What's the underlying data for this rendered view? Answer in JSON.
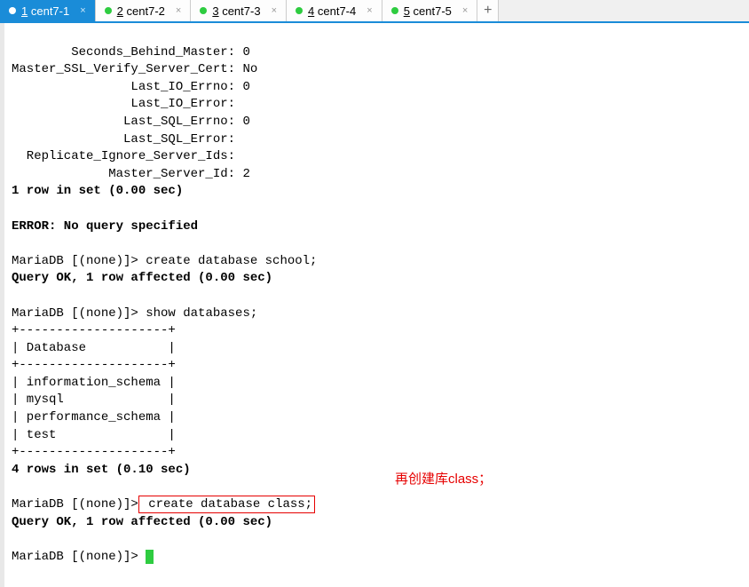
{
  "tabs": [
    {
      "num": "1",
      "label": "cent7-1",
      "active": true
    },
    {
      "num": "2",
      "label": "cent7-2",
      "active": false
    },
    {
      "num": "3",
      "label": "cent7-3",
      "active": false
    },
    {
      "num": "4",
      "label": "cent7-4",
      "active": false
    },
    {
      "num": "5",
      "label": "cent7-5",
      "active": false
    }
  ],
  "close_glyph": "×",
  "add_glyph": "+",
  "terminal": {
    "status_lines": [
      "        Seconds_Behind_Master: 0",
      "Master_SSL_Verify_Server_Cert: No",
      "                Last_IO_Errno: 0",
      "                Last_IO_Error:",
      "               Last_SQL_Errno: 0",
      "               Last_SQL_Error:",
      "  Replicate_Ignore_Server_Ids:",
      "             Master_Server_Id: 2"
    ],
    "row_in_set_1": "1 row in set (0.00 sec)",
    "error_line": "ERROR: No query specified",
    "prompt": "MariaDB [(none)]>",
    "cmd_create_school": " create database school;",
    "ok_1": "Query OK, 1 row affected (0.00 sec)",
    "cmd_show_db": " show databases;",
    "table_border": "+--------------------+",
    "table_header": "| Database           |",
    "table_rows": [
      "| information_schema |",
      "| mysql              |",
      "| performance_schema |",
      "| test               |"
    ],
    "row_in_set_4": "4 rows in set (0.10 sec)",
    "cmd_create_class": " create database class;",
    "ok_2": "Query OK, 1 row affected (0.00 sec)",
    "final_prompt_space": " "
  },
  "annotation": {
    "text": "再创建库class；"
  }
}
